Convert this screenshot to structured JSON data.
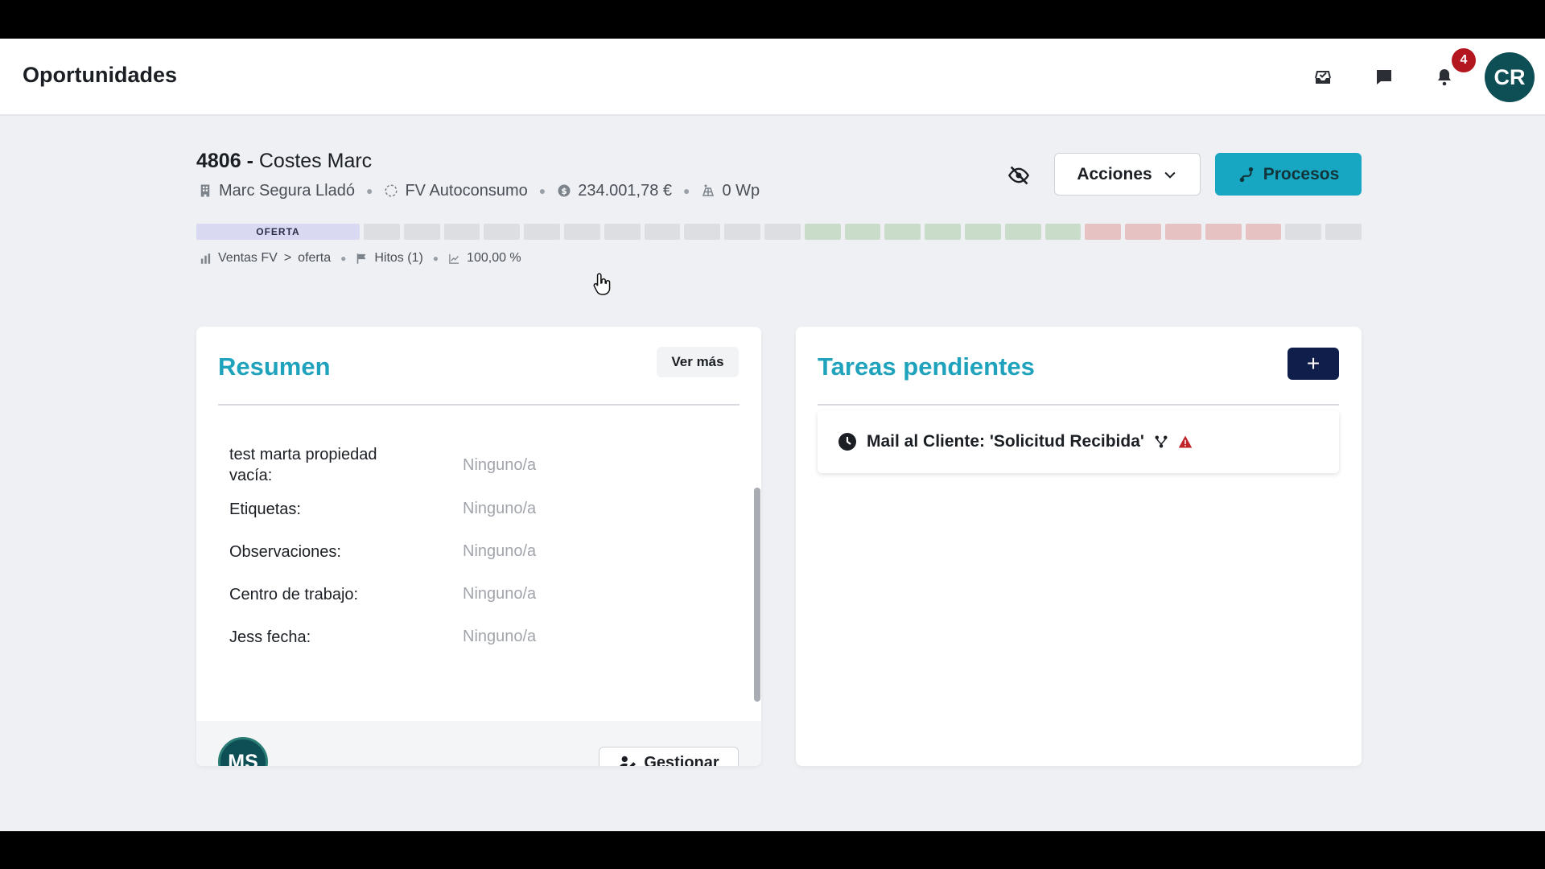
{
  "header": {
    "title": "Oportunidades",
    "notification_count": "4",
    "user_initials": "CR",
    "icons": [
      "inbox-check-icon",
      "chat-icon",
      "bell-icon"
    ]
  },
  "opportunity": {
    "number": "4806",
    "separator": "-",
    "name": "Costes Marc",
    "meta": {
      "company": "Marc Segura Lladó",
      "type": "FV Autoconsumo",
      "amount": "234.001,78 €",
      "power": "0 Wp"
    },
    "actions_label": "Acciones",
    "processes_label": "Procesos",
    "stages": {
      "active_label": "OFERTA",
      "grey_count": 11,
      "green_count": 7,
      "red_count": 5,
      "trailing_grey_count": 2
    },
    "pipeline": {
      "pipeline_name": "Ventas FV",
      "crumb_separator": ">",
      "stage_name": "oferta",
      "milestones": "Hitos (1)",
      "probability": "100,00 %"
    }
  },
  "summary": {
    "title": "Resumen",
    "more_label": "Ver más",
    "properties": [
      {
        "label": "test marta propiedad vacía:",
        "value": "Ninguno/a"
      },
      {
        "label": "Etiquetas:",
        "value": "Ninguno/a"
      },
      {
        "label": "Observaciones:",
        "value": "Ninguno/a"
      },
      {
        "label": "Centro de trabajo:",
        "value": "Ninguno/a"
      },
      {
        "label": "Jess fecha:",
        "value": "Ninguno/a"
      }
    ],
    "owner_initials": "MS",
    "manage_label": "Gestionar"
  },
  "tasks": {
    "title": "Tareas pendientes",
    "add_label": "+",
    "items": [
      {
        "title": "Mail al Cliente: 'Solicitud Recibida'"
      }
    ]
  },
  "colors": {
    "accent": "#1fa3bd",
    "primary_button": "#17a7c2",
    "avatar": "#0e4f56",
    "badge": "#b3161f",
    "warning": "#c0242b",
    "add_button": "#0f1e4a"
  }
}
